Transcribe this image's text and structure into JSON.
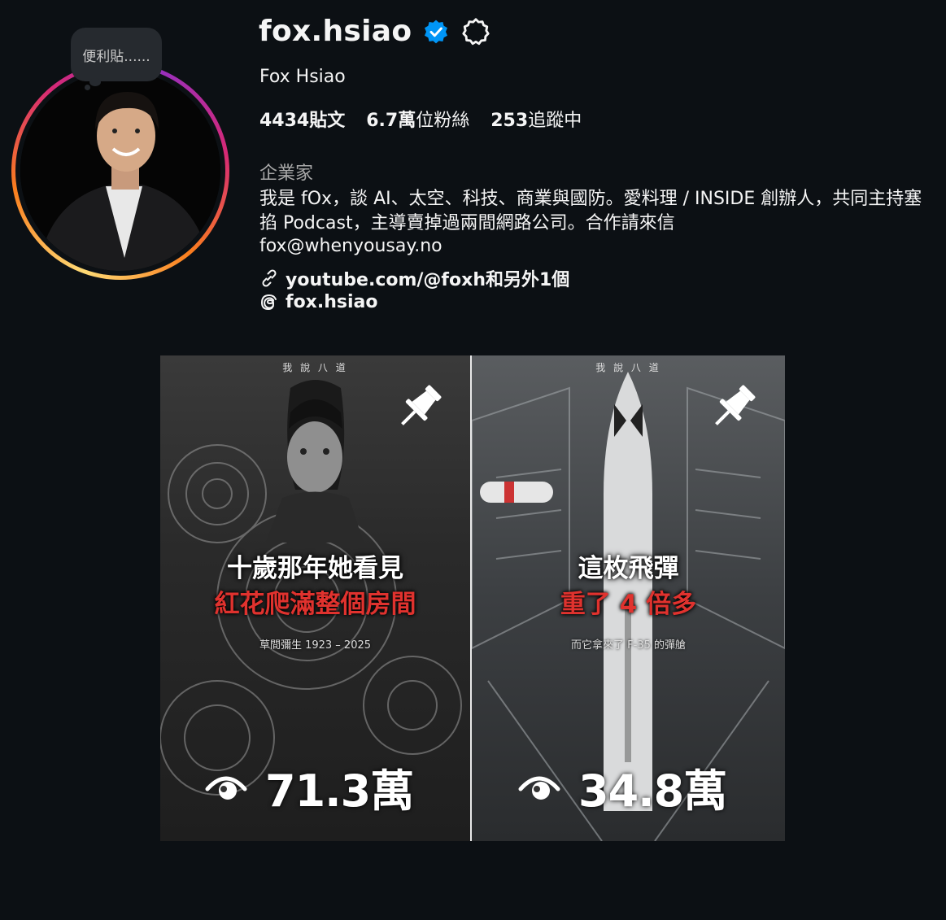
{
  "note": {
    "text": "便利貼......"
  },
  "profile": {
    "username": "fox.hsiao",
    "full_name": "Fox Hsiao",
    "verified_icon": "verified-badge-icon",
    "settings_icon": "settings-gear-icon"
  },
  "stats": {
    "posts_count": "4434",
    "posts_label": "貼文",
    "followers_count": "6.7萬",
    "followers_label": "位粉絲",
    "following_count": "253",
    "following_label": "追蹤中"
  },
  "bio": {
    "category": "企業家",
    "text": "我是 fOx，談 AI、太空、科技、商業與國防。愛料理 / INSIDE 創辦人，共同主持塞掐 Podcast，主導賣掉過兩間網路公司。合作請來信",
    "email": "fox@whenyousay.no",
    "link": "youtube.com/@foxh和另外1個",
    "threads": "fox.hsiao"
  },
  "posts": [
    {
      "header": "我 說 八 道",
      "title_line1": "十歲那年她看見",
      "title_line2": "紅花爬滿整個房間",
      "subtitle": "草間彌生 1923 – 2025",
      "views": "71.3萬",
      "pinned": true
    },
    {
      "header": "我 說 八 道",
      "title_line1": "這枚飛彈",
      "title_line2": "重了 4 倍多",
      "subtitle": "而它拿來了 F-35 的彈艙",
      "views": "34.8萬",
      "pinned": true
    }
  ],
  "colors": {
    "background": "#0c1014",
    "verified_blue": "#0095f6",
    "red_title": "#e0322e"
  }
}
